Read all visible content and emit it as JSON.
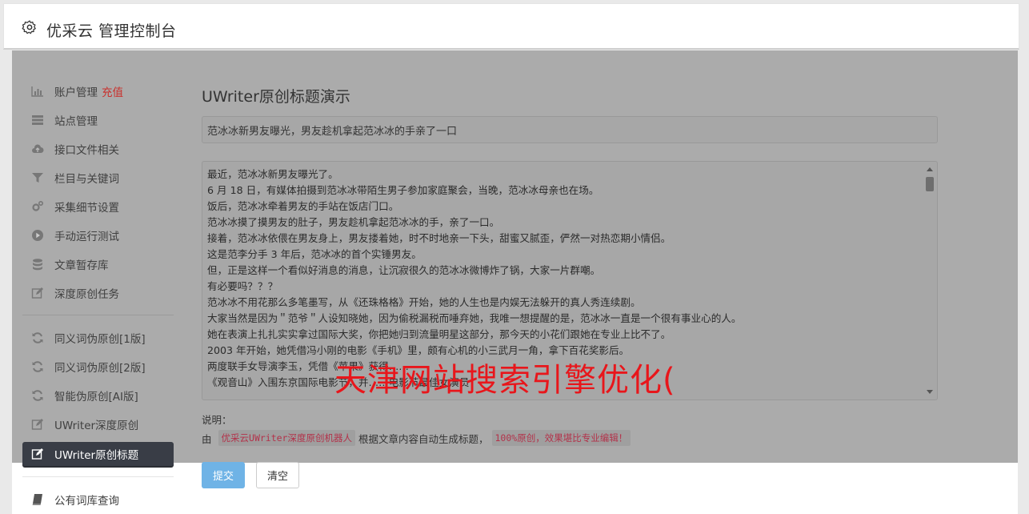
{
  "header": {
    "title": "优采云 管理控制台"
  },
  "sidebar": {
    "items": [
      {
        "label": "账户管理",
        "badge": "充值",
        "icon": "bar-chart-icon"
      },
      {
        "label": "站点管理",
        "icon": "server-icon"
      },
      {
        "label": "接口文件相关",
        "icon": "cloud-upload-icon"
      },
      {
        "label": "栏目与关键词",
        "icon": "filter-icon"
      },
      {
        "label": "采集细节设置",
        "icon": "cogs-icon"
      },
      {
        "label": "手动运行测试",
        "icon": "play-circle-icon"
      },
      {
        "label": "文章暂存库",
        "icon": "database-icon"
      },
      {
        "label": "深度原创任务",
        "icon": "edit-icon"
      },
      {
        "label": "同义词伪原创[1版]",
        "icon": "refresh-icon"
      },
      {
        "label": "同义词伪原创[2版]",
        "icon": "refresh-icon"
      },
      {
        "label": "智能伪原创[AI版]",
        "icon": "refresh-icon"
      },
      {
        "label": "UWriter深度原创",
        "icon": "edit-icon"
      },
      {
        "label": "UWriter原创标题",
        "icon": "edit-icon",
        "active": true
      },
      {
        "label": "公有词库查询",
        "icon": "book-icon"
      }
    ]
  },
  "main": {
    "title": "UWriter原创标题演示",
    "title_value": "范冰冰新男友曝光，男友趁机拿起范冰冰的手亲了一口",
    "article_lines": [
      "最近，范冰冰新男友曝光了。",
      "6 月 18 日，有媒体拍摄到范冰冰带陌生男子参加家庭聚会，当晚，范冰冰母亲也在场。",
      "饭后，范冰冰牵着男友的手站在饭店门口。",
      "范冰冰摸了摸男友的肚子，男友趁机拿起范冰冰的手，亲了一口。",
      "接着，范冰冰依偎在男友身上，男友搂着她，时不时地亲一下头，甜蜜又腻歪，俨然一对热恋期小情侣。",
      "这是范李分手 3 年后，范冰冰的首个实锤男友。",
      "但，正是这样一个看似好消息的消息，让沉寂很久的范冰冰微博炸了锅，大家一片群嘲。",
      "有必要吗？？？",
      "范冰冰不用花那么多笔墨写，从《还珠格格》开始，她的人生也是内娱无法躲开的真人秀连续剧。",
      "大家当然是因为＂范爷＂人设知晓她，因为偷税漏税而唾弃她，我唯一想提醒的是，范冰冰一直是一个很有事业心的人。",
      "她在表演上扎扎实实拿过国际大奖，你把她归到流量明星这部分，那今天的小花们跟她在专业上比不了。",
      "2003 年开始，她凭借冯小刚的电影《手机》里，颇有心机的小三武月一角，拿下百花奖影后。",
      "两度联手女导演李玉，凭借《苹果》获得……",
      "《观音山》入围东京国际电影节，并……电影节最佳女演员"
    ],
    "watermark": "天津网站搜索引擎优化(",
    "note_label": "说明：",
    "note_prefix": "由",
    "note_code1": "优采云UWriter深度原创机器人",
    "note_middle": "根据文章内容自动生成标题，",
    "note_code2": "100%原创，效果堪比专业编辑！",
    "submit_label": "提交",
    "clear_label": "清空"
  },
  "colors": {
    "accent_red": "#c9302c",
    "active_bg": "#393d46",
    "submit_bg": "#6fb3e6",
    "watermark": "#e8161b"
  }
}
